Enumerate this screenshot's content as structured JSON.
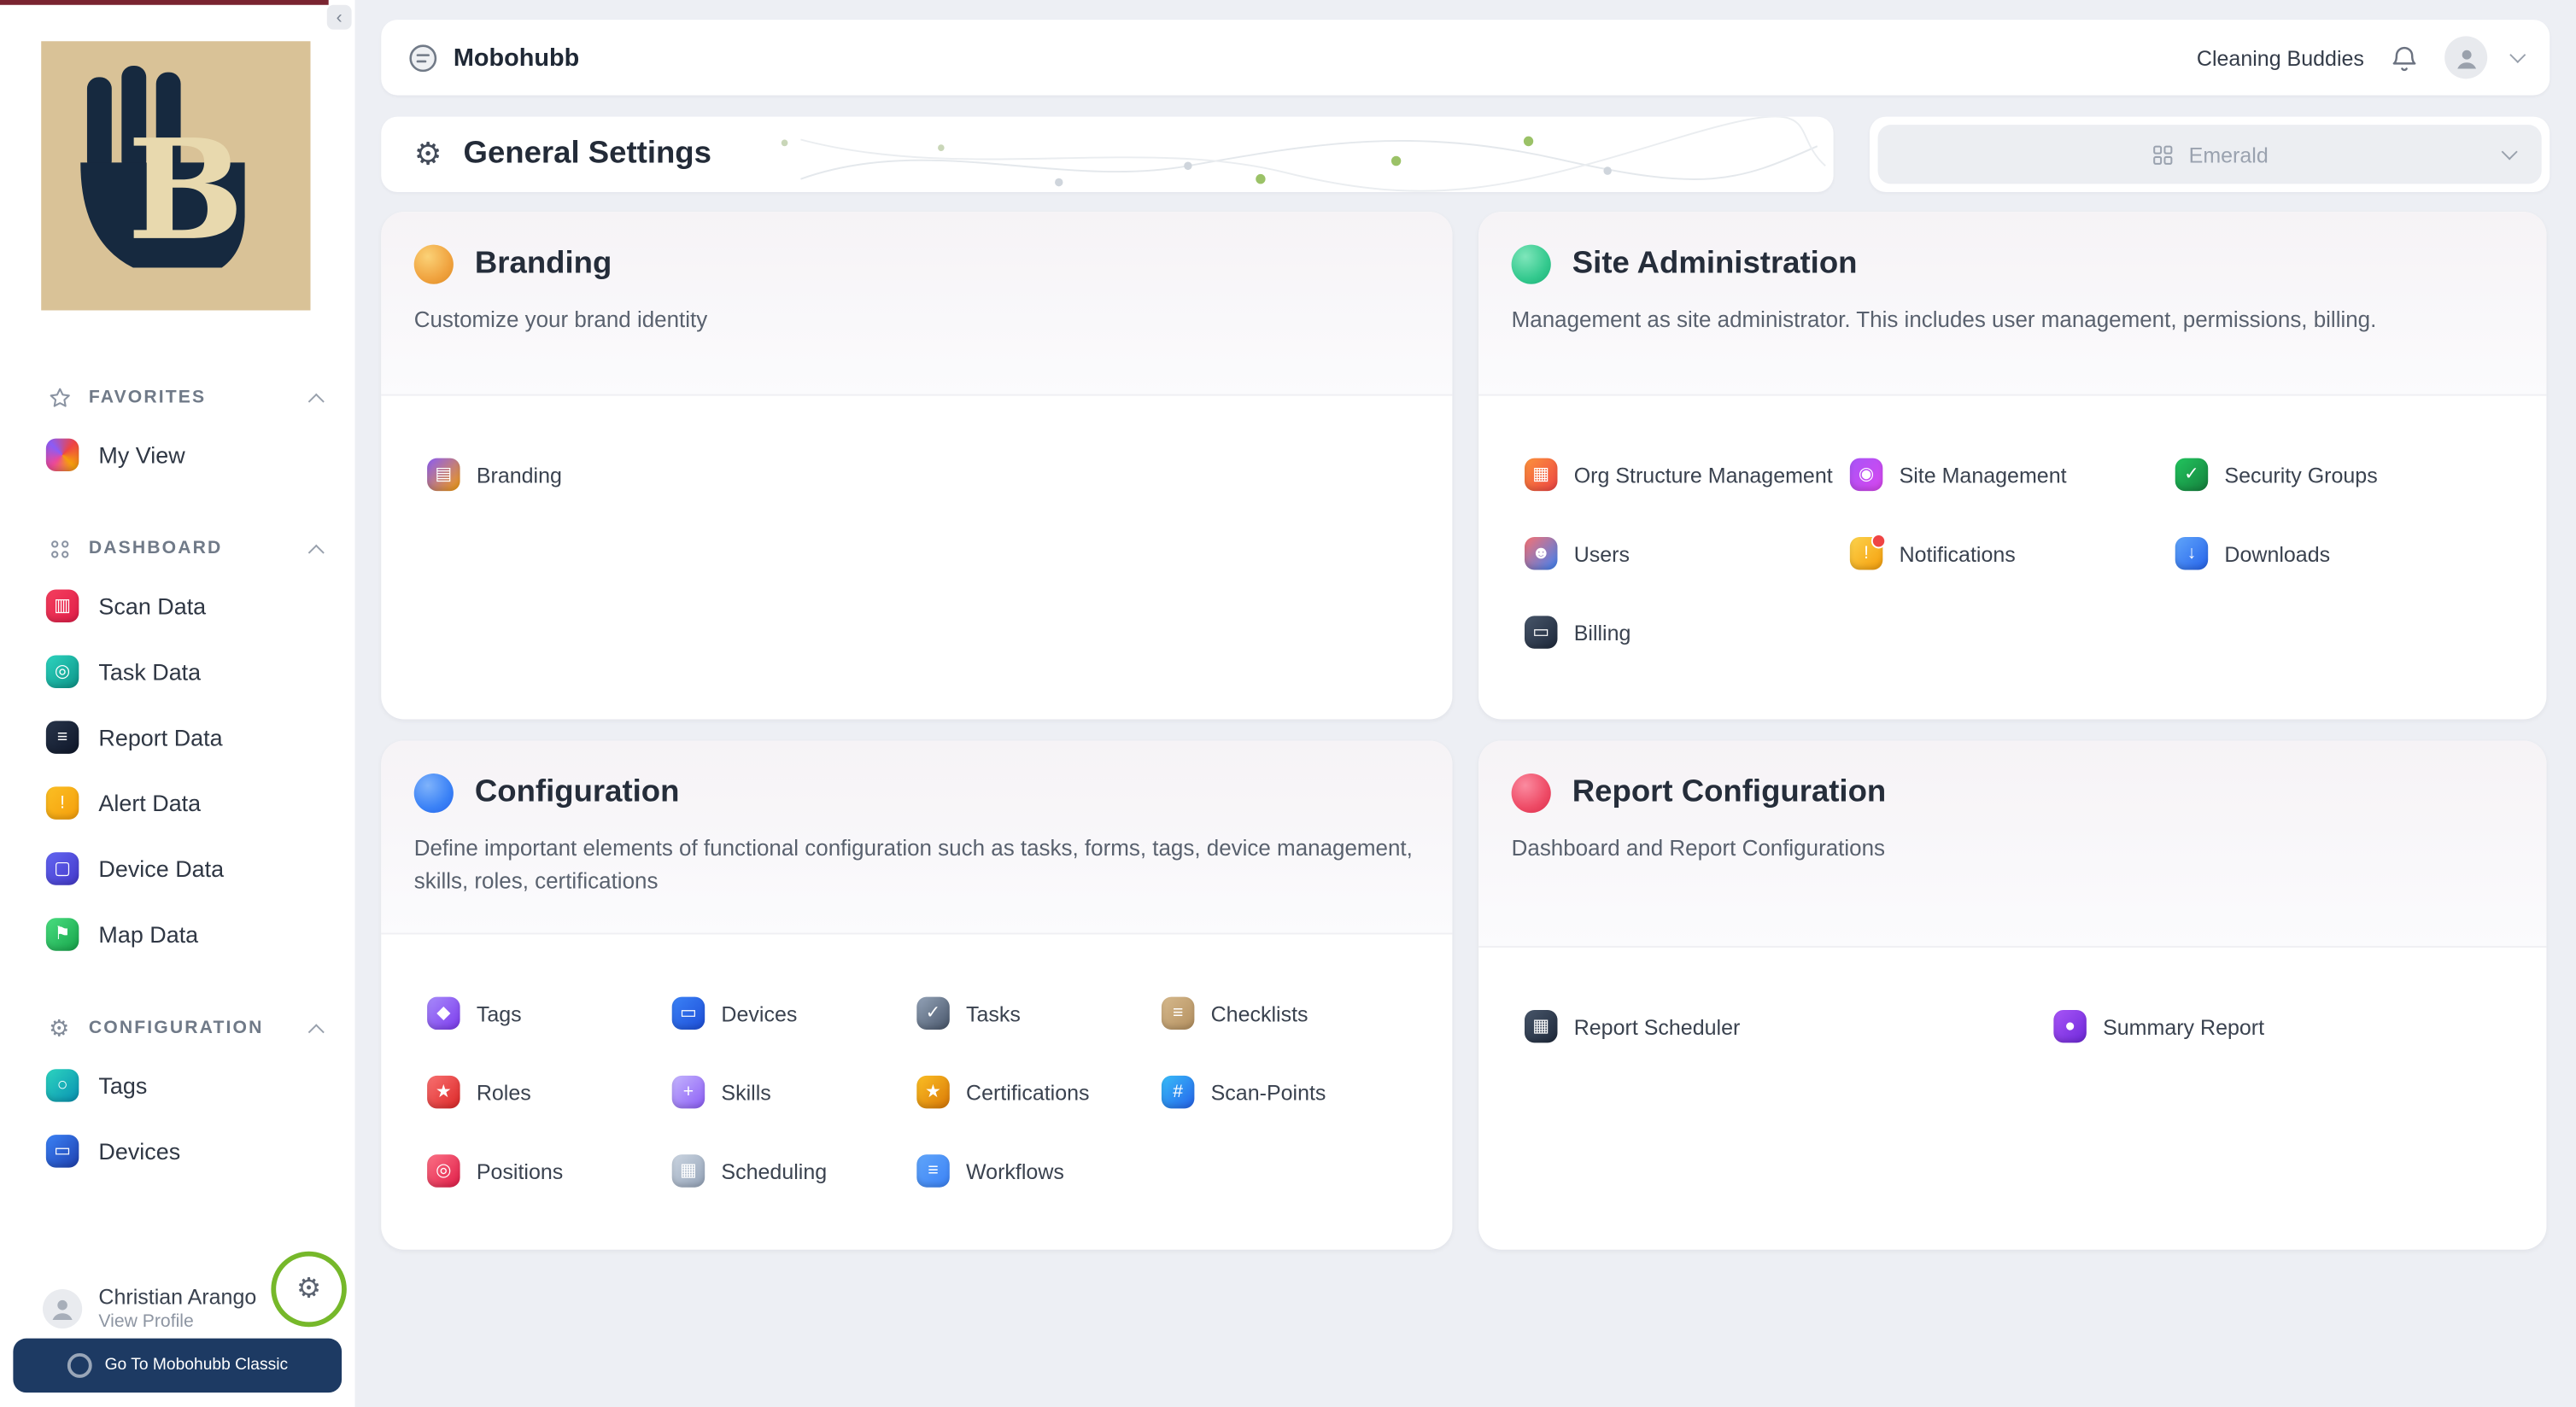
{
  "topbar": {
    "brand": "Mobohubb",
    "org": "Cleaning Buddies"
  },
  "settings_header": {
    "title": "General Settings"
  },
  "theme_select": {
    "value": "Emerald"
  },
  "sidebar": {
    "favorites": {
      "header": "FAVORITES",
      "items": [
        {
          "label": "My View"
        }
      ]
    },
    "dashboard": {
      "header": "DASHBOARD",
      "items": [
        {
          "label": "Scan Data"
        },
        {
          "label": "Task Data"
        },
        {
          "label": "Report Data"
        },
        {
          "label": "Alert Data"
        },
        {
          "label": "Device Data"
        },
        {
          "label": "Map Data"
        }
      ]
    },
    "configuration": {
      "header": "CONFIGURATION",
      "items": [
        {
          "label": "Tags"
        },
        {
          "label": "Devices"
        }
      ]
    },
    "user": {
      "name": "Christian Arango",
      "profile_link": "View Profile"
    },
    "classic_button_label": "Go To Mobohubb Classic"
  },
  "cards": [
    {
      "title": "Branding",
      "subtitle": "Customize your brand identity",
      "items": [
        {
          "label": "Branding"
        }
      ]
    },
    {
      "title": "Site Administration",
      "subtitle": "Management as site administrator. This includes user management, permissions, billing.",
      "items": [
        {
          "label": "Org Structure Management"
        },
        {
          "label": "Site Management"
        },
        {
          "label": "Security Groups"
        },
        {
          "label": "Users"
        },
        {
          "label": "Notifications"
        },
        {
          "label": "Downloads"
        },
        {
          "label": "Billing"
        }
      ]
    },
    {
      "title": "Configuration",
      "subtitle": "Define important elements of functional configuration such as tasks, forms, tags, device management, skills, roles, certifications",
      "items": [
        {
          "label": "Tags"
        },
        {
          "label": "Devices"
        },
        {
          "label": "Tasks"
        },
        {
          "label": "Checklists"
        },
        {
          "label": "Roles"
        },
        {
          "label": "Skills"
        },
        {
          "label": "Certifications"
        },
        {
          "label": "Scan-Points"
        },
        {
          "label": "Positions"
        },
        {
          "label": "Scheduling"
        },
        {
          "label": "Workflows"
        }
      ]
    },
    {
      "title": "Report Configuration",
      "subtitle": "Dashboard and Report Configurations",
      "items": [
        {
          "label": "Report Scheduler"
        },
        {
          "label": "Summary Report"
        }
      ]
    }
  ],
  "icons": {
    "collapse": "‹",
    "gear": "⚙",
    "s_scan": "▥",
    "s_task": "◎",
    "s_report": "≡",
    "s_alert": "!",
    "s_device": "▢",
    "s_map": "⚑",
    "s_tags": "○",
    "s_devices": "▭",
    "branding": "▤",
    "org": "▦",
    "site": "◉",
    "sec": "✓",
    "users": "☻",
    "notif": "!",
    "down": "↓",
    "bill": "▭",
    "tags": "◆",
    "devices": "▭",
    "tasks": "✓",
    "check": "≡",
    "roles": "★",
    "skills": "+",
    "cert": "★",
    "scan": "#",
    "pos": "◎",
    "sched": "▦",
    "work": "≡",
    "rsched": "▦",
    "sum": "●"
  },
  "colors": {
    "accent_branding": "#f0a33f",
    "accent_site_admin": "#34c98e",
    "accent_configuration": "#3b82f6",
    "accent_report": "#ee4b66",
    "classic_button_bg": "#1d3a63",
    "annotation_ring_green": "#76b82a"
  }
}
